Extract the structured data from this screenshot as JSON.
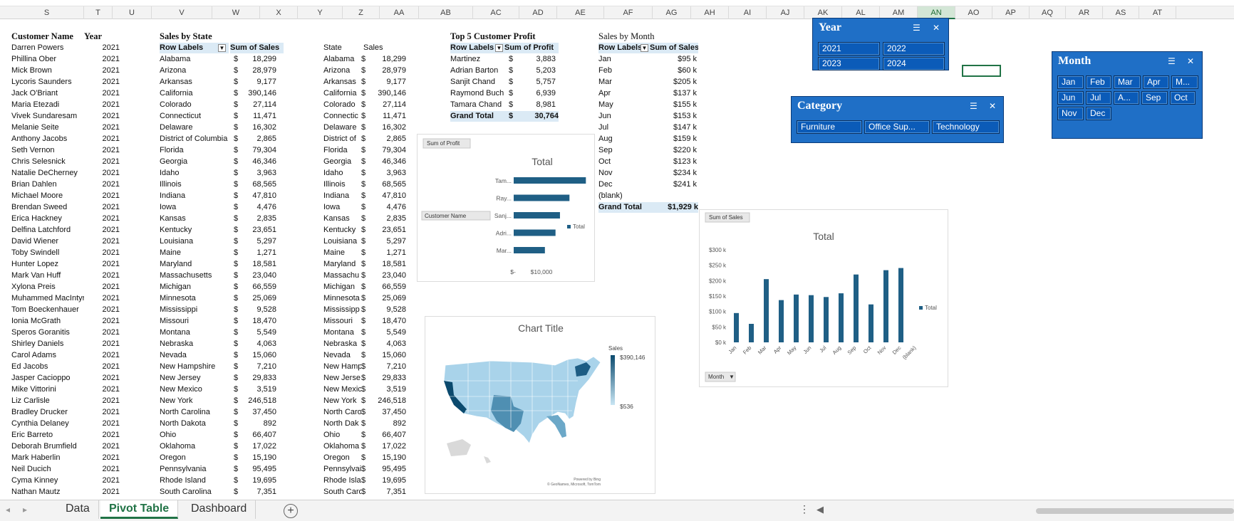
{
  "columns": [
    "S",
    "T",
    "U",
    "V",
    "W",
    "X",
    "Y",
    "Z",
    "AA",
    "AB",
    "AC",
    "AD",
    "AE",
    "AF",
    "AG",
    "AH",
    "AI",
    "AJ",
    "AK",
    "AL",
    "AM",
    "AN",
    "AO",
    "AP",
    "AQ",
    "AR",
    "AS",
    "AT"
  ],
  "selected_column": "AN",
  "customers": {
    "header_name": "Customer Name",
    "header_year": "Year",
    "rows": [
      [
        "Darren Powers",
        "2021"
      ],
      [
        "Phillina Ober",
        "2021"
      ],
      [
        "Mick Brown",
        "2021"
      ],
      [
        "Lycoris Saunders",
        "2021"
      ],
      [
        "Jack O'Briant",
        "2021"
      ],
      [
        "Maria Etezadi",
        "2021"
      ],
      [
        "Vivek Sundaresam",
        "2021"
      ],
      [
        "Melanie Seite",
        "2021"
      ],
      [
        "Anthony Jacobs",
        "2021"
      ],
      [
        "Seth Vernon",
        "2021"
      ],
      [
        "Chris Selesnick",
        "2021"
      ],
      [
        "Natalie DeCherney",
        "2021"
      ],
      [
        "Brian Dahlen",
        "2021"
      ],
      [
        "Michael Moore",
        "2021"
      ],
      [
        "Brendan Sweed",
        "2021"
      ],
      [
        "Erica Hackney",
        "2021"
      ],
      [
        "Delfina Latchford",
        "2021"
      ],
      [
        "David Wiener",
        "2021"
      ],
      [
        "Toby Swindell",
        "2021"
      ],
      [
        "Hunter Lopez",
        "2021"
      ],
      [
        "Mark Van Huff",
        "2021"
      ],
      [
        "Xylona Preis",
        "2021"
      ],
      [
        "Muhammed MacIntyre",
        "2021"
      ],
      [
        "Tom Boeckenhauer",
        "2021"
      ],
      [
        "Ionia McGrath",
        "2021"
      ],
      [
        "Speros Goranitis",
        "2021"
      ],
      [
        "Shirley Daniels",
        "2021"
      ],
      [
        "Carol Adams",
        "2021"
      ],
      [
        "Ed Jacobs",
        "2021"
      ],
      [
        "Jasper Cacioppo",
        "2021"
      ],
      [
        "Mike Vittorini",
        "2021"
      ],
      [
        "Liz Carlisle",
        "2021"
      ],
      [
        "Bradley Drucker",
        "2021"
      ],
      [
        "Cynthia Delaney",
        "2021"
      ],
      [
        "Eric Barreto",
        "2021"
      ],
      [
        "Deborah Brumfield",
        "2021"
      ],
      [
        "Mark Haberlin",
        "2021"
      ],
      [
        "Neil Ducich",
        "2021"
      ],
      [
        "Cyma Kinney",
        "2021"
      ],
      [
        "Nathan Mautz",
        "2021"
      ]
    ]
  },
  "sales_by_state": {
    "title": "Sales by State",
    "row_labels": "Row Labels",
    "sum_label": "Sum of Sales",
    "currency": "$",
    "rows": [
      [
        "Alabama",
        "18,299"
      ],
      [
        "Arizona",
        "28,979"
      ],
      [
        "Arkansas",
        "9,177"
      ],
      [
        "California",
        "390,146"
      ],
      [
        "Colorado",
        "27,114"
      ],
      [
        "Connecticut",
        "11,471"
      ],
      [
        "Delaware",
        "16,302"
      ],
      [
        "District of Columbia",
        "2,865"
      ],
      [
        "Florida",
        "79,304"
      ],
      [
        "Georgia",
        "46,346"
      ],
      [
        "Idaho",
        "3,963"
      ],
      [
        "Illinois",
        "68,565"
      ],
      [
        "Indiana",
        "47,810"
      ],
      [
        "Iowa",
        "4,476"
      ],
      [
        "Kansas",
        "2,835"
      ],
      [
        "Kentucky",
        "23,651"
      ],
      [
        "Louisiana",
        "5,297"
      ],
      [
        "Maine",
        "1,271"
      ],
      [
        "Maryland",
        "18,581"
      ],
      [
        "Massachusetts",
        "23,040"
      ],
      [
        "Michigan",
        "66,559"
      ],
      [
        "Minnesota",
        "25,069"
      ],
      [
        "Mississippi",
        "9,528"
      ],
      [
        "Missouri",
        "18,470"
      ],
      [
        "Montana",
        "5,549"
      ],
      [
        "Nebraska",
        "4,063"
      ],
      [
        "Nevada",
        "15,060"
      ],
      [
        "New Hampshire",
        "7,210"
      ],
      [
        "New Jersey",
        "29,833"
      ],
      [
        "New Mexico",
        "3,519"
      ],
      [
        "New York",
        "246,518"
      ],
      [
        "North Carolina",
        "37,450"
      ],
      [
        "North Dakota",
        "892"
      ],
      [
        "Ohio",
        "66,407"
      ],
      [
        "Oklahoma",
        "17,022"
      ],
      [
        "Oregon",
        "15,190"
      ],
      [
        "Pennsylvania",
        "95,495"
      ],
      [
        "Rhode Island",
        "19,695"
      ],
      [
        "South Carolina",
        "7,351"
      ]
    ]
  },
  "state_table": {
    "header_state": "State",
    "header_sales": "Sales",
    "truncated": [
      "Alabama",
      "Arizona",
      "Arkansas",
      "California",
      "Colorado",
      "Connectic",
      "Delaware",
      "District of",
      "Florida",
      "Georgia",
      "Idaho",
      "Illinois",
      "Indiana",
      "Iowa",
      "Kansas",
      "Kentucky",
      "Louisiana",
      "Maine",
      "Maryland",
      "Massachu",
      "Michigan",
      "Minnesota",
      "Mississipp",
      "Missouri",
      "Montana",
      "Nebraska",
      "Nevada",
      "New Hamp",
      "New Jerse",
      "New Mexic",
      "New York",
      "North Caro",
      "North Dak",
      "Ohio",
      "Oklahoma",
      "Oregon",
      "Pennsylvai",
      "Rhode Isla",
      "South Caro"
    ]
  },
  "top5": {
    "title": "Top 5 Customer Profit",
    "row_labels": "Row Labels",
    "sum_label": "Sum of Profit",
    "currency": "$",
    "rows": [
      [
        "Martinez",
        "3,883"
      ],
      [
        "Adrian Barton",
        "5,203"
      ],
      [
        "Sanjit Chand",
        "5,757"
      ],
      [
        "Raymond Buch",
        "6,939"
      ],
      [
        "Tamara Chand",
        "8,981"
      ]
    ],
    "total_label": "Grand Total",
    "total_value": "30,764"
  },
  "sales_by_month": {
    "title": "Sales by Month",
    "row_labels": "Row Labels",
    "sum_label": "Sum of Sales",
    "rows": [
      [
        "Jan",
        "$95 k"
      ],
      [
        "Feb",
        "$60 k"
      ],
      [
        "Mar",
        "$205 k"
      ],
      [
        "Apr",
        "$137 k"
      ],
      [
        "May",
        "$155 k"
      ],
      [
        "Jun",
        "$153 k"
      ],
      [
        "Jul",
        "$147 k"
      ],
      [
        "Aug",
        "$159 k"
      ],
      [
        "Sep",
        "$220 k"
      ],
      [
        "Oct",
        "$123 k"
      ],
      [
        "Nov",
        "$234 k"
      ],
      [
        "Dec",
        "$241 k"
      ],
      [
        "(blank)",
        ""
      ]
    ],
    "total_label": "Grand Total",
    "total_value": "$1,929 k"
  },
  "chart_data": [
    {
      "type": "bar",
      "title": "Total",
      "field_button": "Sum of Profit",
      "axis_field": "Customer Name",
      "categories": [
        "Mar...",
        "Adri...",
        "Sanj...",
        "Ray...",
        "Tam..."
      ],
      "series": [
        {
          "name": "Total",
          "values": [
            3883,
            5203,
            5757,
            6939,
            8981
          ]
        }
      ],
      "xticks": [
        "$-",
        "$10,000"
      ],
      "xlim": [
        0,
        16000
      ],
      "legend": "right",
      "color": "#1f5f85"
    },
    {
      "type": "bar",
      "title": "Total",
      "field_button": "Sum of Sales",
      "axis_field": "Month",
      "categories": [
        "Jan",
        "Feb",
        "Mar",
        "Apr",
        "May",
        "Jun",
        "Jul",
        "Aug",
        "Sep",
        "Oct",
        "Nov",
        "Dec",
        "(blank)"
      ],
      "series": [
        {
          "name": "Total",
          "values": [
            95,
            60,
            205,
            137,
            155,
            153,
            147,
            159,
            220,
            123,
            234,
            241,
            0
          ]
        }
      ],
      "yticks": [
        "$0 k",
        "$50 k",
        "$100 k",
        "$150 k",
        "$200 k",
        "$250 k",
        "$300 k"
      ],
      "ylim": [
        0,
        300
      ],
      "legend": "right",
      "color": "#1f5f85"
    }
  ],
  "map_chart": {
    "title": "Chart Title",
    "legend_title": "Sales",
    "legend_max": "$390,146",
    "legend_min": "$536",
    "credit1": "Powered by Bing",
    "credit2": "© GeoNames, Microsoft, TomTom"
  },
  "slicers": {
    "year": {
      "title": "Year",
      "items": [
        "2021",
        "2022",
        "2023",
        "2024"
      ]
    },
    "category": {
      "title": "Category",
      "items": [
        "Furniture",
        "Office Sup...",
        "Technology"
      ]
    },
    "month": {
      "title": "Month",
      "items": [
        "Jan",
        "Feb",
        "Mar",
        "Apr",
        "M...",
        "Jun",
        "Jul",
        "A...",
        "Sep",
        "Oct",
        "Nov",
        "Dec"
      ]
    }
  },
  "tabs": [
    "Data",
    "Pivot Table",
    "Dashboard"
  ],
  "active_tab": "Pivot Table",
  "colors": {
    "slicer": "#1f6fc6",
    "bar": "#1f5f85",
    "pivot_header": "#dbeaf5",
    "excel_green": "#217346"
  }
}
